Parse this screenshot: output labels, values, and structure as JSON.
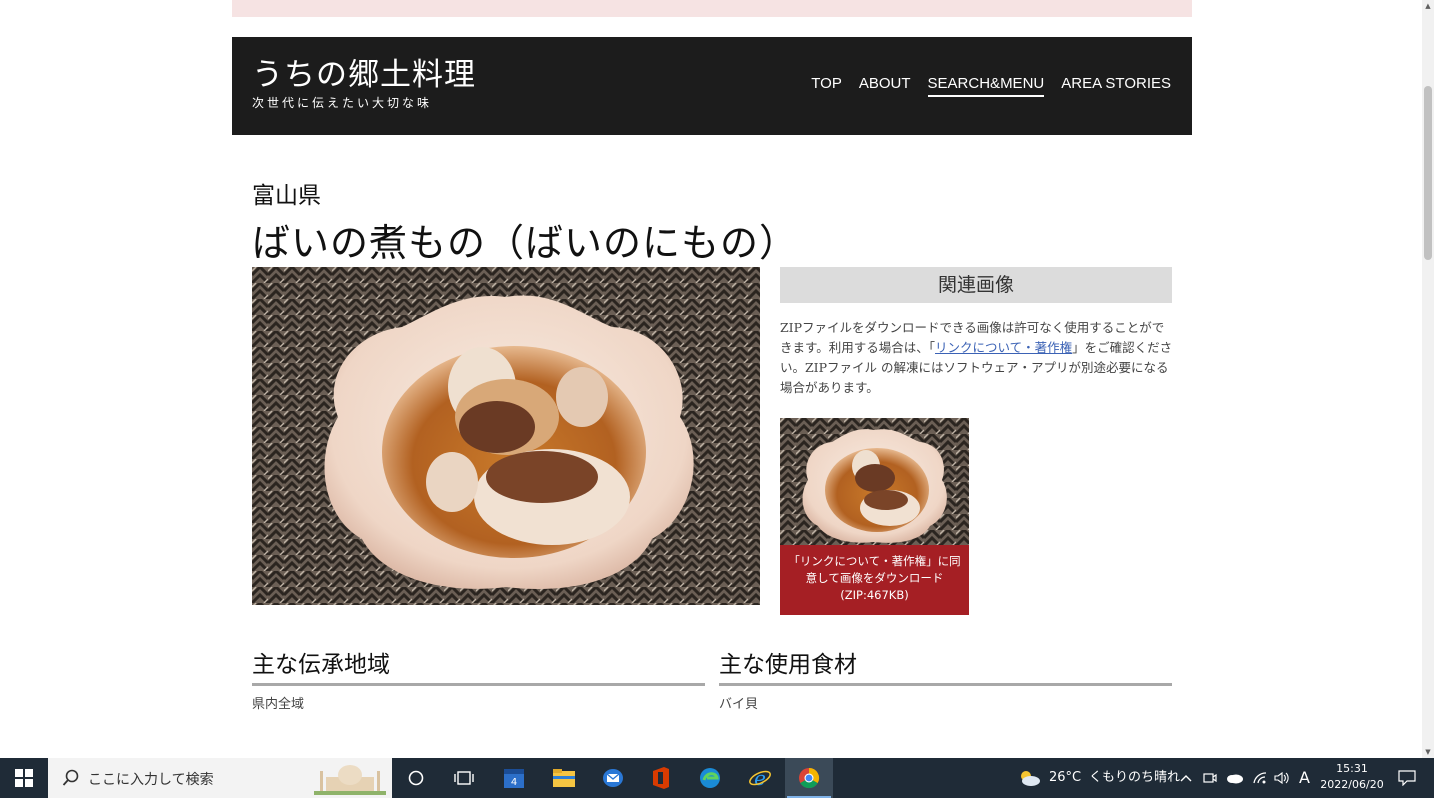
{
  "header": {
    "logo_title": "うちの郷土料理",
    "logo_subtitle": "次世代に伝えたい大切な味",
    "nav": [
      {
        "label": "TOP"
      },
      {
        "label": "ABOUT"
      },
      {
        "label": "SEARCH&MENU"
      },
      {
        "label": "AREA STORIES"
      }
    ],
    "active_nav": "SEARCH&MENU"
  },
  "dish": {
    "prefecture": "富山県",
    "title": "ばいの煮もの（ばいのにもの）"
  },
  "related": {
    "heading": "関連画像",
    "text_before_link": "ZIPファイルをダウンロードできる画像は許可なく使用することができます。利用する場合は、「",
    "link_text": "リンクについて・著作権",
    "text_after_link": "」をご確認ください。ZIPファイル の解凍にはソフトウェア・アプリが別途必要になる場合があります。",
    "download_line1": "「リンクについて・著作権」に同",
    "download_line2": "意して画像をダウンロード",
    "download_line3": "(ZIP:467KB)"
  },
  "sections": {
    "region_heading": "主な伝承地域",
    "region_value": "県内全域",
    "ingredients_heading": "主な使用食材",
    "ingredients_value": "バイ貝"
  },
  "taskbar": {
    "search_placeholder": "ここに入力して検索",
    "weather": "26°C",
    "weather_desc": "くもりのち晴れ",
    "ime": "A",
    "time": "15:31",
    "date": "2022/06/20"
  },
  "colors": {
    "header_bg": "#1c1c1c",
    "download_button": "#a51f24",
    "pink_bar": "#f6e3e3",
    "link": "#3b62b5"
  }
}
